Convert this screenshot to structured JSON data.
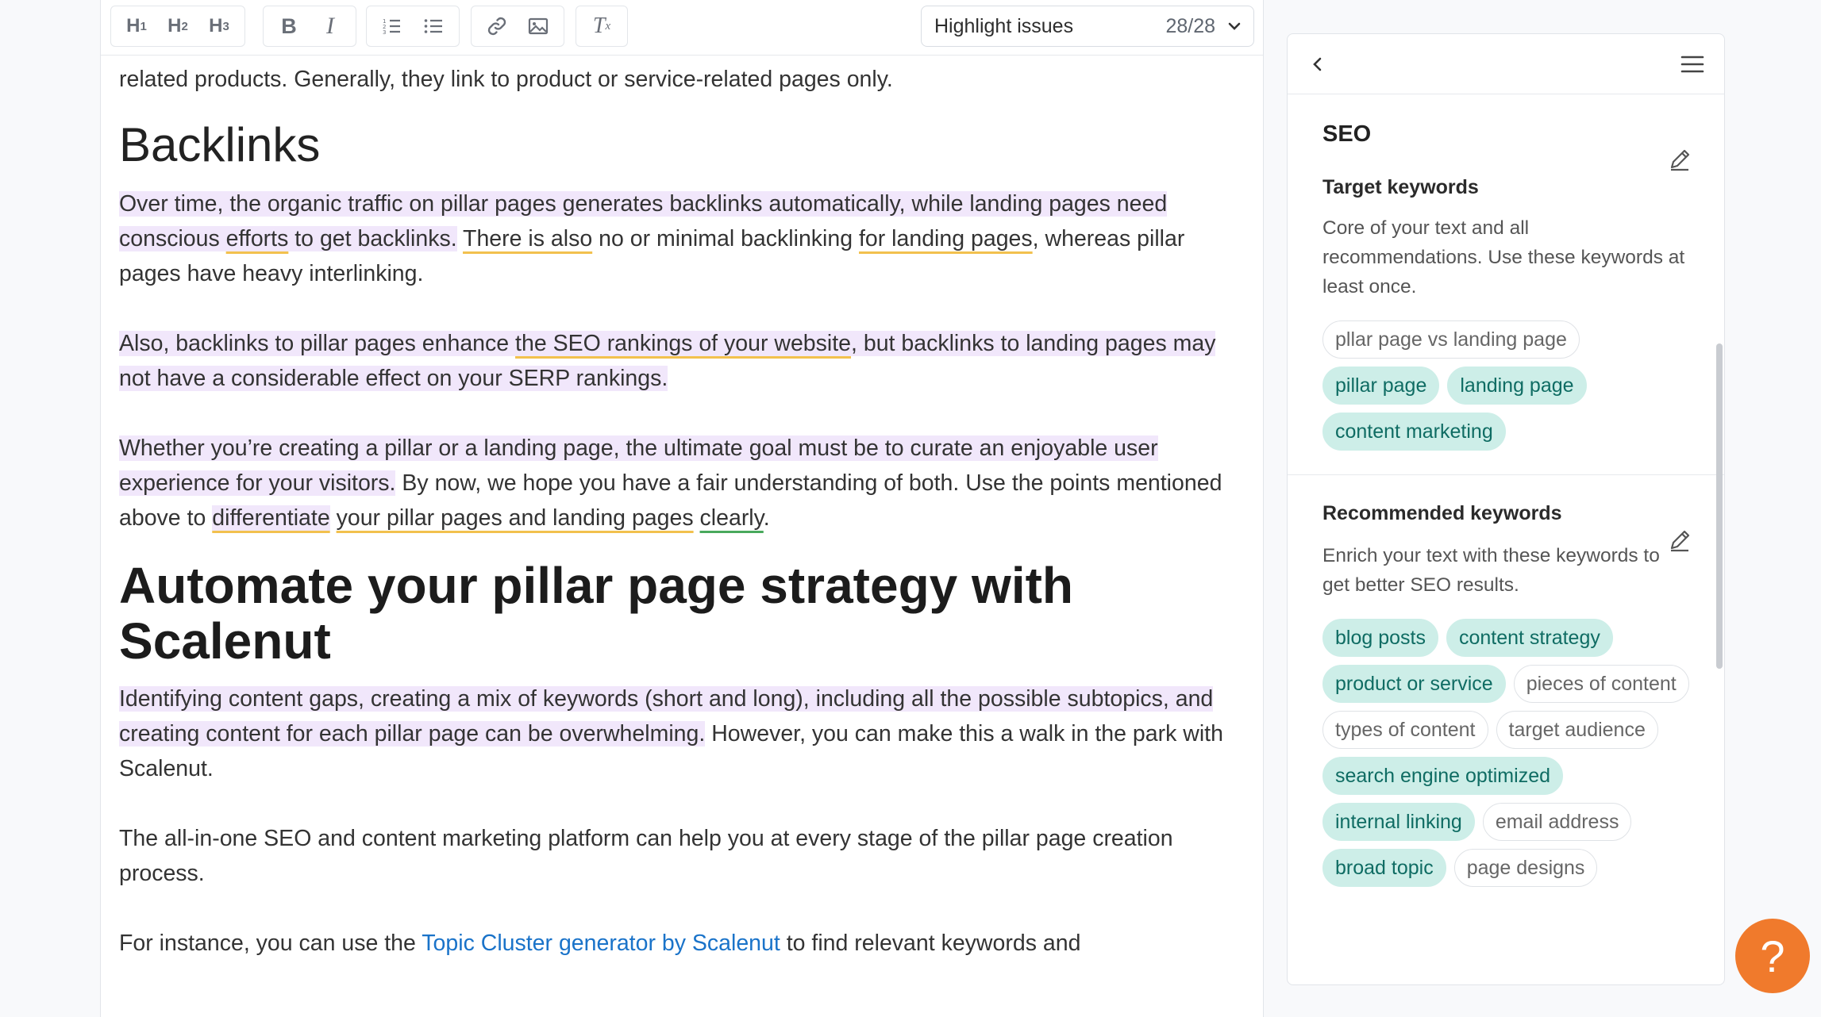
{
  "toolbar": {
    "h1": "H",
    "h1_sub": "1",
    "h2": "H",
    "h2_sub": "2",
    "h3": "H",
    "h3_sub": "3",
    "bold": "B",
    "italic": "I",
    "clear": "T",
    "clear_sub": "x",
    "issues_label": "Highlight issues",
    "issues_count": "28/28"
  },
  "doc": {
    "p0": "related products. Generally, they link to product or service-related pages only.",
    "h_backlinks": "Backlinks",
    "p1": {
      "a": "Over time, the organic traffic on pillar pages generates backlinks automatically, while landing pages need conscious ",
      "b": "efforts",
      "c": " to get backlinks.",
      "d": " ",
      "e": "There is also",
      "f": " no or minimal backlinking ",
      "g": "for landing pages",
      "h": ", whereas pillar pages have heavy interlinking."
    },
    "p2": {
      "a": "Also, backlinks to pillar pages enhance ",
      "b": "the SEO rankings of your website",
      "c": ", but backlinks to landing pages may not have a considerable effect on your SERP rankings."
    },
    "p3": {
      "a": "Whether you’re creating a pillar or a landing page, the ultimate goal must be to curate an enjoyable user experience for your visitors.",
      "b": " By now, we hope you have a fair understanding of both. Use the points mentioned above to ",
      "c": "differentiate",
      "d": " ",
      "e": "your pillar pages and landing pages",
      "f": " ",
      "g": "clearly",
      "h": "."
    },
    "h_automate": "Automate your pillar page strategy with Scalenut",
    "p4": {
      "a": "Identifying content gaps, creating a mix of keywords (short and long), including all the possible subtopics, and creating content for each pillar page can be overwhelming.",
      "b": " However, you can make this a walk in the park with Scalenut."
    },
    "p5": "The all-in-one SEO and content marketing platform can help you at every stage of the pillar page creation process.",
    "p6": {
      "a": "For instance, you can use the ",
      "link": "Topic Cluster generator by Scalenut",
      "b": " to find relevant keywords and"
    }
  },
  "panel": {
    "title": "SEO",
    "target": {
      "title": "Target keywords",
      "desc": "Core of your text and all recommendations. Use these keywords at least once.",
      "chips": [
        {
          "label": "pllar page vs landing page",
          "used": false
        },
        {
          "label": "pillar page",
          "used": true
        },
        {
          "label": "landing page",
          "used": true
        },
        {
          "label": "content marketing",
          "used": true
        }
      ]
    },
    "recommended": {
      "title": "Recommended keywords",
      "desc": "Enrich your text with these keywords to get better SEO results.",
      "chips": [
        {
          "label": "blog posts",
          "used": true
        },
        {
          "label": "content strategy",
          "used": true
        },
        {
          "label": "product or service",
          "used": true
        },
        {
          "label": "pieces of content",
          "used": false
        },
        {
          "label": "types of content",
          "used": false
        },
        {
          "label": "target audience",
          "used": false
        },
        {
          "label": "search engine optimized",
          "used": true
        },
        {
          "label": "internal linking",
          "used": true
        },
        {
          "label": "email address",
          "used": false
        },
        {
          "label": "broad topic",
          "used": true
        },
        {
          "label": "page designs",
          "used": false
        }
      ]
    }
  },
  "help": {
    "label": "?"
  },
  "colors": {
    "accent_chip": "#cdeee8",
    "highlight": "#f1e7fb",
    "underline_yellow": "#f2c14e",
    "underline_green": "#49a95d",
    "help_button": "#f07a2c",
    "link": "#1a73c9"
  },
  "icons": [
    "link-icon",
    "image-icon",
    "ordered-list-icon",
    "bullet-list-icon",
    "chevron-down-icon",
    "chevron-left-icon",
    "hamburger-menu-icon",
    "pencil-icon"
  ]
}
